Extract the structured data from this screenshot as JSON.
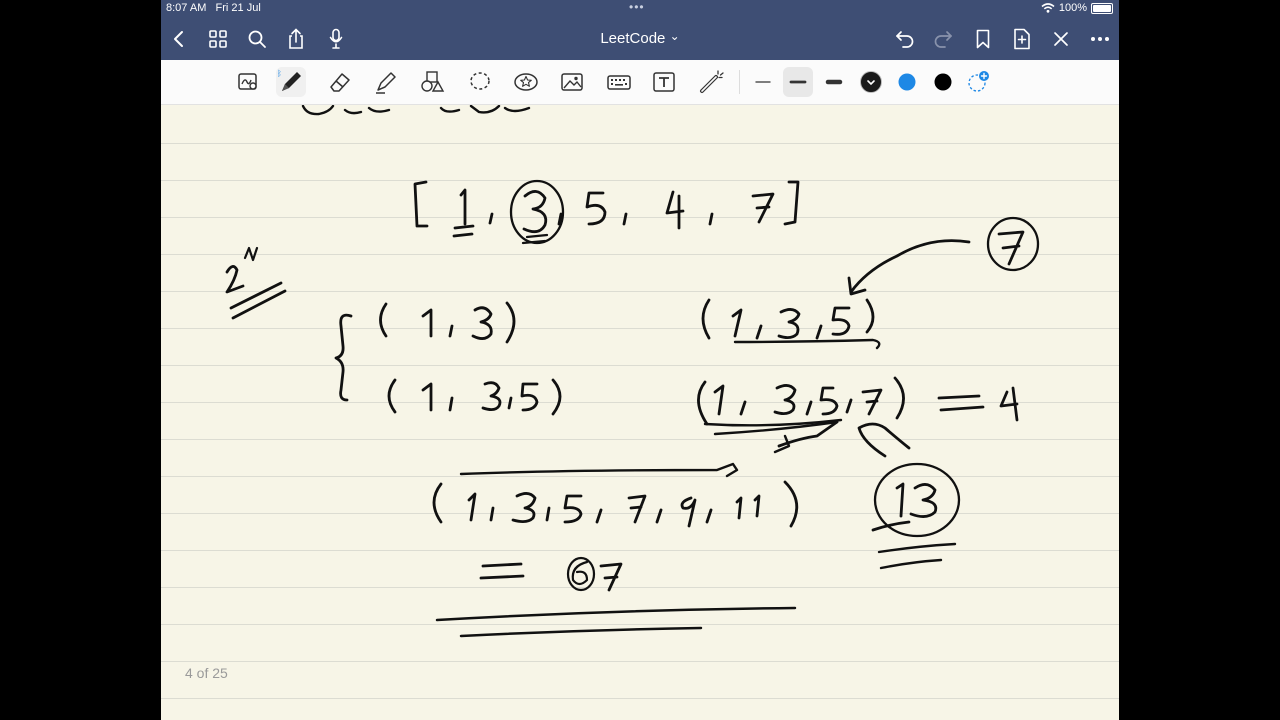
{
  "status_bar": {
    "time": "8:07 AM",
    "date": "Fri 21 Jul",
    "battery": "100%"
  },
  "nav_bar": {
    "title": "LeetCode",
    "title_chevron": "⌄"
  },
  "toolbar": {
    "tools": [
      "lasso-zoom-icon",
      "pen-icon",
      "eraser-icon",
      "highlighter-icon",
      "shapes-icon",
      "lasso-icon",
      "sticker-icon",
      "image-icon",
      "keyboard-icon",
      "text-icon",
      "laser-icon"
    ],
    "stroke_widths": [
      "thin",
      "medium",
      "thick"
    ],
    "colors": [
      "#1a1a1a",
      "#1e88e5",
      "#000000"
    ]
  },
  "note": {
    "page_indicator": "4 of 25",
    "handwriting": {
      "array": [
        "[",
        "1",
        ",",
        "3",
        ",",
        "5",
        ",",
        "4",
        ",",
        "7",
        "]"
      ],
      "side_note": "2^N",
      "left_set_1": [
        "(",
        "1",
        ",",
        "3",
        ")"
      ],
      "left_set_2": [
        "(",
        "1",
        ",",
        "3",
        ",",
        "5",
        ")"
      ],
      "right_set_1": [
        "(",
        "1",
        ",",
        "3",
        ",",
        "5",
        ")"
      ],
      "right_set_2": [
        "(",
        "1",
        ",",
        "3",
        ",",
        "5",
        ",",
        "7",
        ")",
        "=",
        "4"
      ],
      "circled_7": "7",
      "long_set": [
        "(",
        "1",
        ",",
        "3",
        ",",
        "5",
        ",",
        "7",
        ",",
        "9",
        ",",
        "11",
        ")"
      ],
      "long_result": [
        "=",
        "6",
        "7"
      ],
      "circled_13": "13"
    }
  }
}
